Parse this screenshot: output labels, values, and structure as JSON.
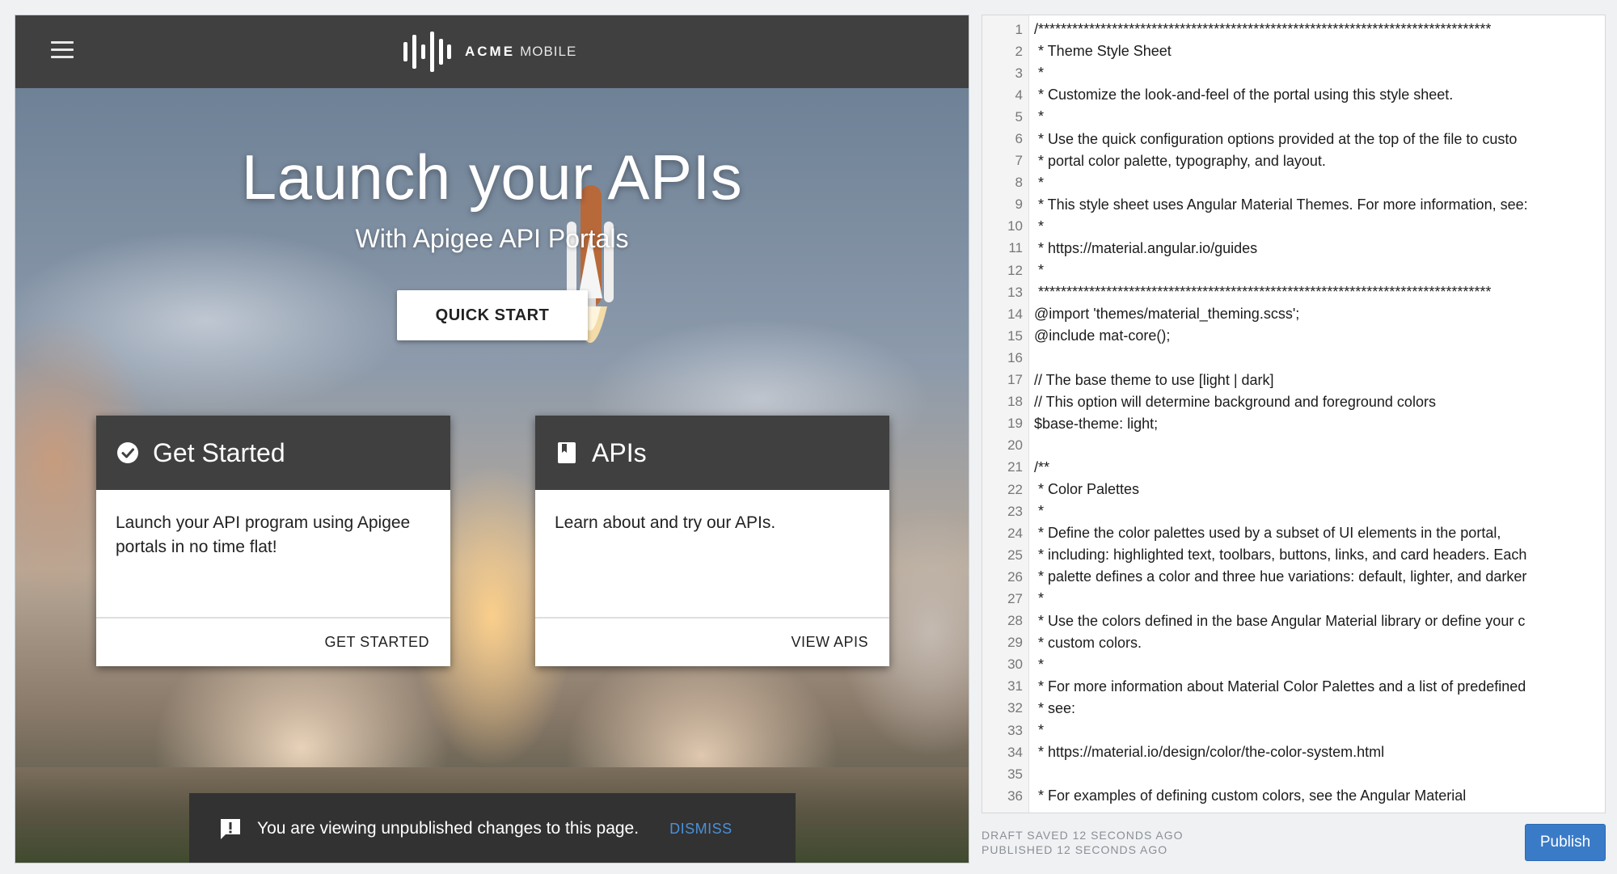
{
  "preview": {
    "brand": {
      "name": "ACME",
      "sub": "MOBILE"
    },
    "hero": {
      "title": "Launch your APIs",
      "subtitle": "With Apigee API Portals",
      "cta": "QUICK START"
    },
    "cards": [
      {
        "icon": "check-circle-icon",
        "title": "Get Started",
        "body": "Launch your API program using Apigee portals in no time flat!",
        "link": "GET STARTED"
      },
      {
        "icon": "book-icon",
        "title": "APIs",
        "body": "Learn about and try our APIs.",
        "link": "VIEW APIS"
      }
    ],
    "snackbar": {
      "icon": "alert-icon",
      "message": "You are viewing unpublished changes to this page.",
      "action": "DISMISS"
    }
  },
  "editor": {
    "lines": [
      "/********************************************************************************",
      " * Theme Style Sheet",
      " *",
      " * Customize the look-and-feel of the portal using this style sheet.",
      " *",
      " * Use the quick configuration options provided at the top of the file to custo",
      " * portal color palette, typography, and layout.",
      " *",
      " * This style sheet uses Angular Material Themes. For more information, see:",
      " *",
      " * https://material.angular.io/guides",
      " *",
      " ********************************************************************************",
      "@import 'themes/material_theming.scss';",
      "@include mat-core();",
      "",
      "// The base theme to use [light | dark]",
      "// This option will determine background and foreground colors",
      "$base-theme: light;",
      "",
      "/**",
      " * Color Palettes",
      " *",
      " * Define the color palettes used by a subset of UI elements in the portal,",
      " * including: highlighted text, toolbars, buttons, links, and card headers. Each",
      " * palette defines a color and three hue variations: default, lighter, and darker",
      " *",
      " * Use the colors defined in the base Angular Material library or define your c",
      " * custom colors.",
      " *",
      " * For more information about Material Color Palettes and a list of predefined",
      " * see:",
      " *",
      " * https://material.io/design/color/the-color-system.html",
      "",
      " * For examples of defining custom colors, see the Angular Material"
    ]
  },
  "status": {
    "draft": "DRAFT SAVED 12 SECONDS AGO",
    "published": "PUBLISHED 12 SECONDS AGO"
  },
  "publish_label": "Publish",
  "colors": {
    "toolbar": "#404040",
    "accent": "#3a7bc8",
    "snackbar": "#323232",
    "dismiss": "#4a90d9"
  }
}
